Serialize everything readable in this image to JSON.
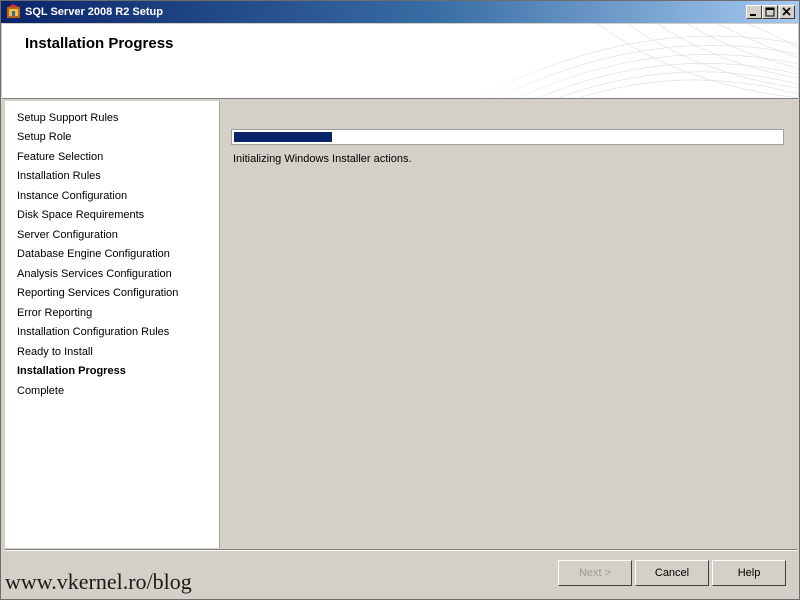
{
  "window": {
    "title": "SQL Server 2008 R2 Setup",
    "controls": [
      "minimize-icon",
      "maximize-icon",
      "close-icon"
    ]
  },
  "header": {
    "title": "Installation Progress"
  },
  "nav": {
    "items": [
      {
        "label": "Setup Support Rules"
      },
      {
        "label": "Setup Role"
      },
      {
        "label": "Feature Selection"
      },
      {
        "label": "Installation Rules"
      },
      {
        "label": "Instance Configuration"
      },
      {
        "label": "Disk Space Requirements"
      },
      {
        "label": "Server Configuration"
      },
      {
        "label": "Database Engine Configuration"
      },
      {
        "label": "Analysis Services Configuration"
      },
      {
        "label": "Reporting Services Configuration"
      },
      {
        "label": "Error Reporting"
      },
      {
        "label": "Installation Configuration Rules"
      },
      {
        "label": "Ready to Install"
      },
      {
        "label": "Installation Progress",
        "active": true
      },
      {
        "label": "Complete"
      }
    ]
  },
  "progress": {
    "fraction": 0.18,
    "status": "Initializing Windows Installer actions.",
    "color": "#0a246a"
  },
  "buttons": {
    "next": "Next >",
    "cancel": "Cancel",
    "help": "Help"
  },
  "watermark": "www.vkernel.ro/blog"
}
